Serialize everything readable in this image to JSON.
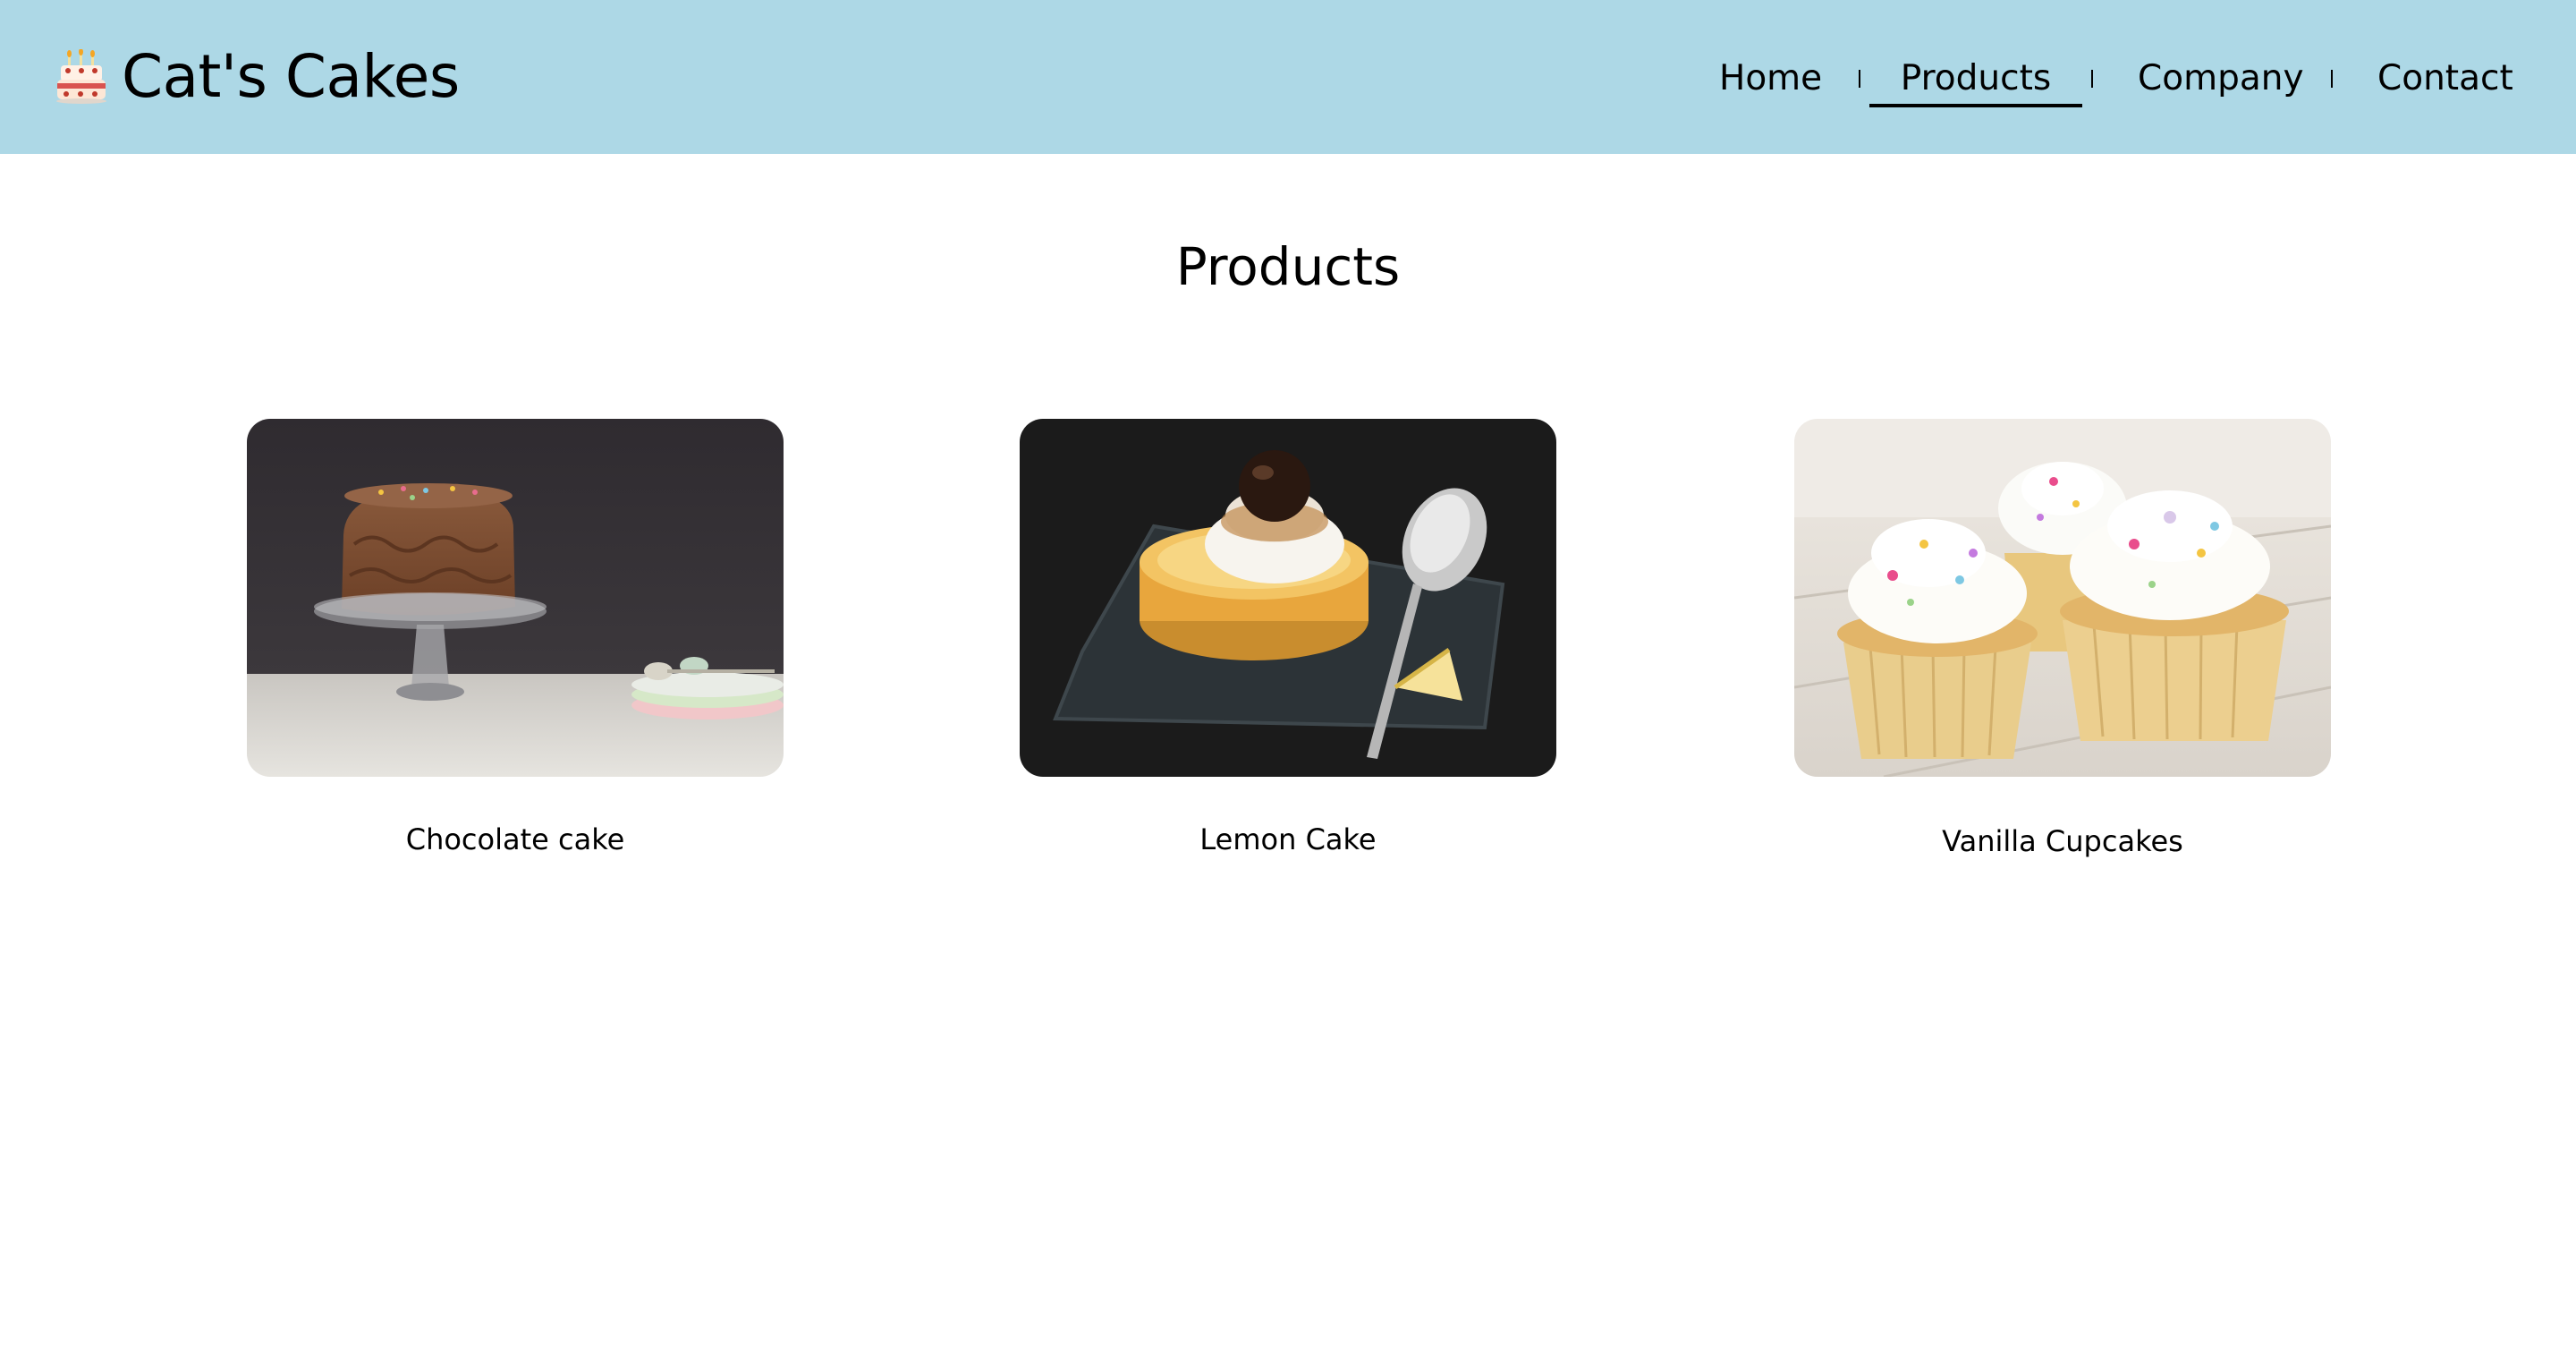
{
  "header": {
    "brand_name": "Cat's Cakes",
    "brand_icon": "birthday-cake-icon",
    "background": "#add8e6"
  },
  "nav": {
    "items": [
      {
        "label": "Home",
        "active": false
      },
      {
        "label": "Products",
        "active": true
      },
      {
        "label": "Company",
        "active": false
      },
      {
        "label": "Contact",
        "active": false
      }
    ]
  },
  "main": {
    "title": "Products",
    "products": [
      {
        "name": "Chocolate cake",
        "image": "chocolate-cake-photo"
      },
      {
        "name": "Lemon Cake",
        "image": "lemon-cake-photo"
      },
      {
        "name": "Vanilla Cupcakes",
        "image": "vanilla-cupcakes-photo"
      }
    ]
  }
}
